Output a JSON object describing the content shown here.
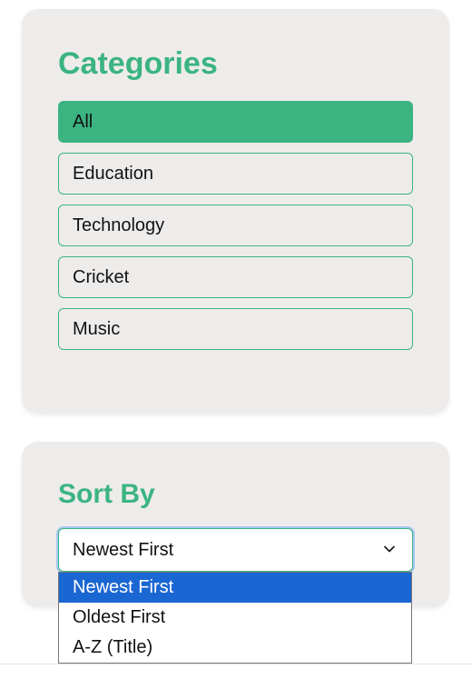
{
  "categories": {
    "title": "Categories",
    "items": [
      {
        "label": "All",
        "active": true
      },
      {
        "label": "Education",
        "active": false
      },
      {
        "label": "Technology",
        "active": false
      },
      {
        "label": "Cricket",
        "active": false
      },
      {
        "label": "Music",
        "active": false
      }
    ]
  },
  "sort": {
    "title": "Sort By",
    "selected": "Newest First",
    "options": [
      "Newest First",
      "Oldest First",
      "A-Z (Title)"
    ],
    "selected_index": 0
  },
  "colors": {
    "accent": "#3bb482",
    "card_bg": "#eeeceb",
    "option_highlight": "#1a66d2"
  },
  "icons": {
    "select_chevron": "chevron-down-icon"
  }
}
